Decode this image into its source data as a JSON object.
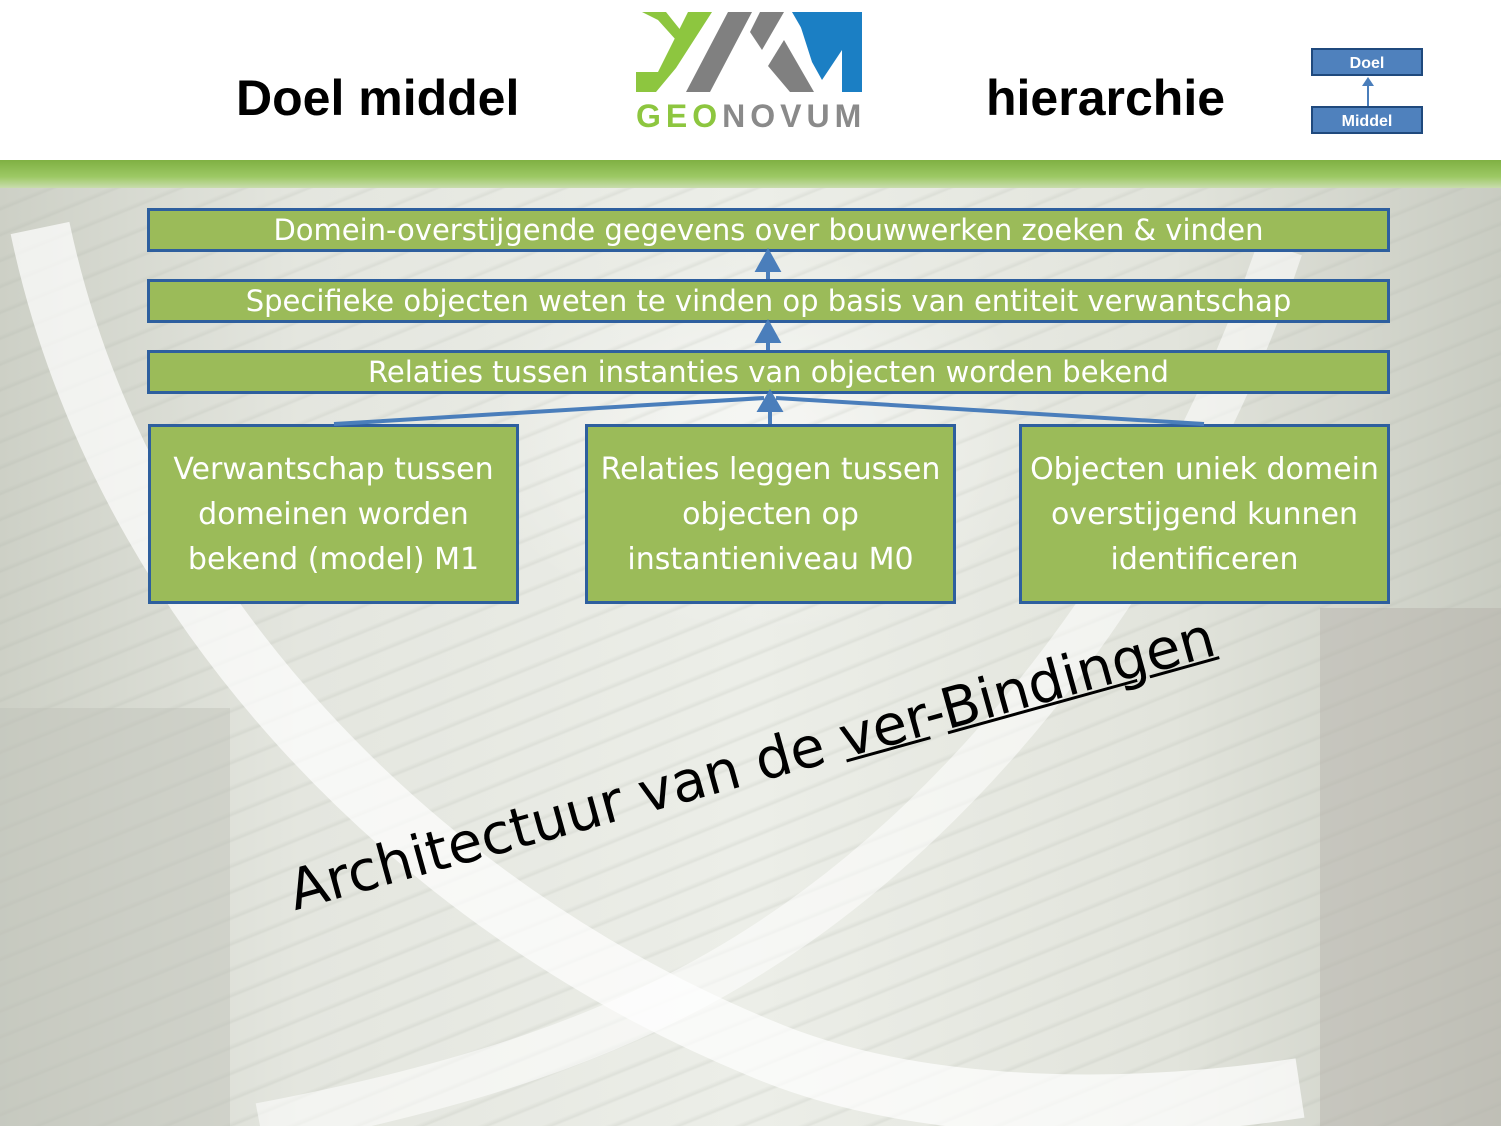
{
  "header": {
    "title_left": "Doel middel",
    "title_right": "hierarchie",
    "logo_prefix": "GEO",
    "logo_suffix": "NOVUM",
    "mini_top": "Doel",
    "mini_bottom": "Middel"
  },
  "diagram": {
    "levels": [
      "Domein-overstijgende gegevens over bouwwerken zoeken & vinden",
      "Specifieke objecten weten te vinden op basis van entiteit verwantschap",
      "Relaties tussen instanties van objecten worden bekend"
    ],
    "boxes": [
      "Verwantschap tussen domeinen worden bekend (model) M1",
      "Relaties leggen tussen objecten op instantieniveau M0",
      "Objecten uniek domein overstijgend kunnen identificeren"
    ]
  },
  "tagline": {
    "part1": "Architectuur van de ",
    "part2": "ver",
    "part3": "-",
    "part4": "Bindingen"
  },
  "colors": {
    "box_fill": "#9bbb59",
    "box_border": "#2e5f9e",
    "arrow": "#4a7ebb",
    "logo_green": "#8dc63f",
    "logo_grey": "#808080",
    "logo_blue": "#1b7fc4"
  }
}
